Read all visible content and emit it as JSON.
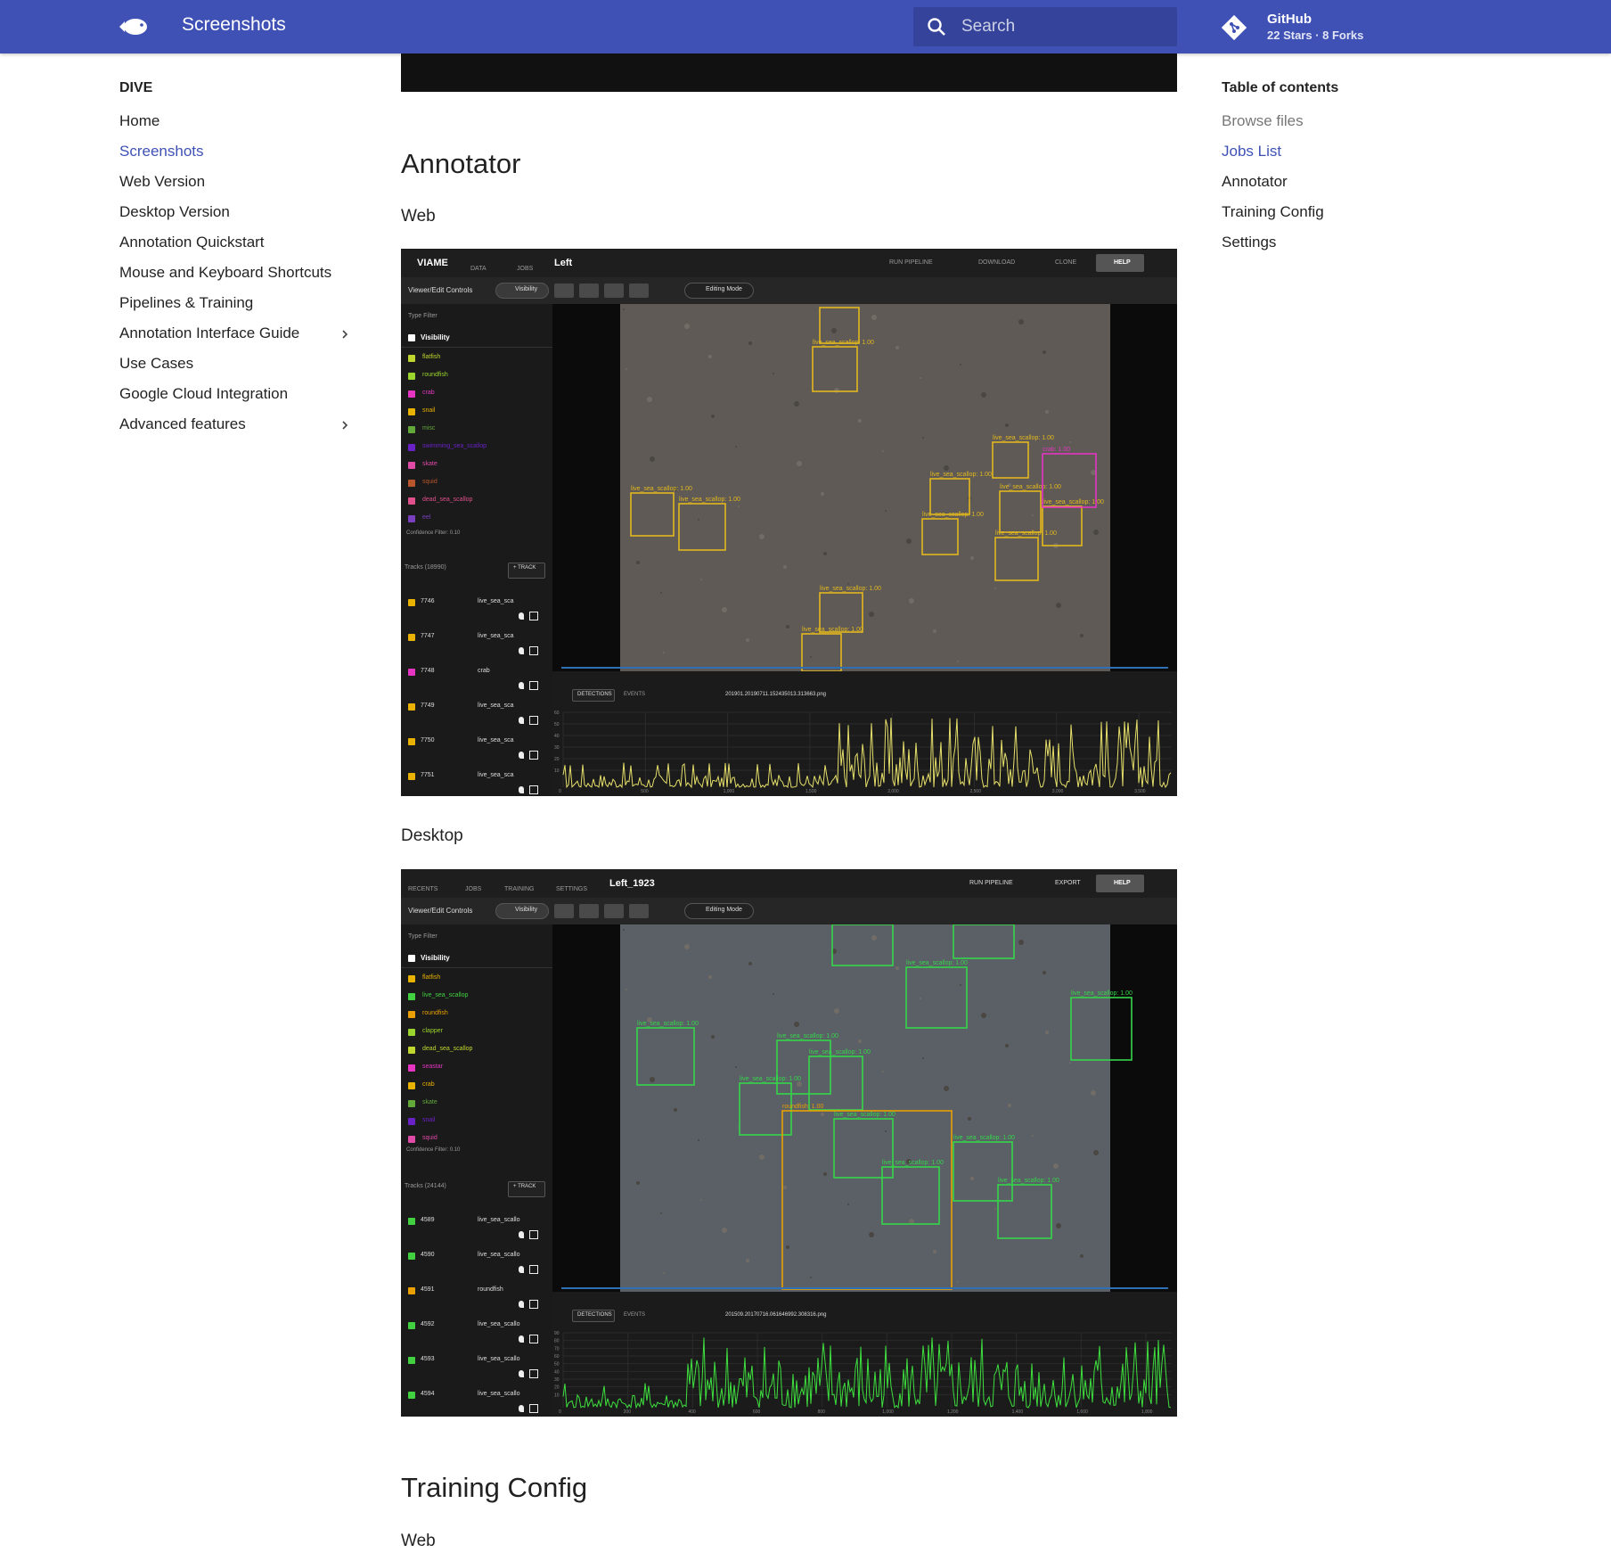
{
  "header": {
    "site_title": "Screenshots",
    "search_placeholder": "Search",
    "repo_name": "GitHub",
    "repo_facts": "22 Stars · 8 Forks",
    "brand_color": "#3f51b5"
  },
  "nav": {
    "title": "DIVE",
    "items": [
      {
        "label": "Home",
        "active": false,
        "expandable": false
      },
      {
        "label": "Screenshots",
        "active": true,
        "expandable": false
      },
      {
        "label": "Web Version",
        "active": false,
        "expandable": false
      },
      {
        "label": "Desktop Version",
        "active": false,
        "expandable": false
      },
      {
        "label": "Annotation Quickstart",
        "active": false,
        "expandable": false
      },
      {
        "label": "Mouse and Keyboard Shortcuts",
        "active": false,
        "expandable": false
      },
      {
        "label": "Pipelines & Training",
        "active": false,
        "expandable": false
      },
      {
        "label": "Annotation Interface Guide",
        "active": false,
        "expandable": true
      },
      {
        "label": "Use Cases",
        "active": false,
        "expandable": false
      },
      {
        "label": "Google Cloud Integration",
        "active": false,
        "expandable": false
      },
      {
        "label": "Advanced features",
        "active": false,
        "expandable": true
      }
    ]
  },
  "toc": {
    "title": "Table of contents",
    "items": [
      {
        "label": "Browse files",
        "state": "passed"
      },
      {
        "label": "Jobs List",
        "state": "active"
      },
      {
        "label": "Annotator",
        "state": "normal"
      },
      {
        "label": "Training Config",
        "state": "normal"
      },
      {
        "label": "Settings",
        "state": "normal"
      }
    ]
  },
  "content": {
    "annotator_heading": "Annotator",
    "web_label": "Web",
    "desktop_label": "Desktop",
    "training_heading": "Training Config",
    "training_web_label": "Web"
  },
  "screenshots": {
    "web": {
      "nav_items": [
        "VIAME",
        "DATA",
        "JOBS"
      ],
      "dataset_name": "Left",
      "actions": [
        "RUN PIPELINE",
        "DOWNLOAD",
        "CLONE",
        "HELP"
      ],
      "controls_label": "Viewer/Edit Controls",
      "visibility_label": "Visibility",
      "editing_label": "Editing Mode",
      "type_filter": "Type Filter",
      "types": [
        {
          "name": "flatfish",
          "color": "#c0d62c"
        },
        {
          "name": "roundfish",
          "color": "#9bd42c"
        },
        {
          "name": "crab",
          "color": "#e535c3"
        },
        {
          "name": "snail",
          "color": "#e9b200"
        },
        {
          "name": "misc",
          "color": "#62a83a"
        },
        {
          "name": "swimming_sea_scallop",
          "color": "#6a22c7"
        },
        {
          "name": "skate",
          "color": "#e04aa8"
        },
        {
          "name": "squid",
          "color": "#b8552c"
        },
        {
          "name": "dead_sea_scallop",
          "color": "#e0508a"
        },
        {
          "name": "eel",
          "color": "#7a3fbf"
        }
      ],
      "confidence_filter": "Confidence Filter: 0.10",
      "tracks_label": "Tracks (18990)",
      "track_button": "+ TRACK",
      "tracks": [
        {
          "id": "7746",
          "type": "live_sea_sca",
          "color": "#e9b200"
        },
        {
          "id": "7747",
          "type": "live_sea_sca",
          "color": "#e9b200"
        },
        {
          "id": "7748",
          "type": "crab",
          "color": "#e535c3"
        },
        {
          "id": "7749",
          "type": "live_sea_sca",
          "color": "#e9b200"
        },
        {
          "id": "7750",
          "type": "live_sea_sca",
          "color": "#e9b200"
        },
        {
          "id": "7751",
          "type": "live_sea_sca",
          "color": "#e9b200"
        }
      ],
      "timeline_tabs": [
        "DETECTIONS",
        "EVENTS"
      ],
      "frame_name": "201901.20190711.152435013.313663.png",
      "box_label": "live_sea_scallop: 1.00",
      "box_color": "#e2b81d",
      "crab_label": "crab: 1.00",
      "crab_color": "#e535c3",
      "x_ticks": [
        "0",
        "500",
        "1,000",
        "1,500",
        "2,000",
        "2,500",
        "3,000",
        "3,500"
      ],
      "y_ticks": [
        "60",
        "50",
        "40",
        "30",
        "20",
        "10"
      ],
      "plot_color": "#e6e06a"
    },
    "desktop": {
      "nav_items": [
        "RECENTS",
        "JOBS",
        "TRAINING",
        "SETTINGS"
      ],
      "dataset_name": "Left_1923",
      "actions": [
        "RUN PIPELINE",
        "EXPORT",
        "HELP"
      ],
      "controls_label": "Viewer/Edit Controls",
      "visibility_label": "Visibility",
      "editing_label": "Editing Mode",
      "type_filter": "Type Filter",
      "types": [
        {
          "name": "flatfish",
          "color": "#e9b200"
        },
        {
          "name": "live_sea_scallop",
          "color": "#40d040"
        },
        {
          "name": "roundfish",
          "color": "#e9a000"
        },
        {
          "name": "clapper",
          "color": "#9bd42c"
        },
        {
          "name": "dead_sea_scallop",
          "color": "#c0d62c"
        },
        {
          "name": "seastar",
          "color": "#e535c3"
        },
        {
          "name": "crab",
          "color": "#e9b200"
        },
        {
          "name": "skate",
          "color": "#62a83a"
        },
        {
          "name": "snail",
          "color": "#6a22c7"
        },
        {
          "name": "squid",
          "color": "#e04aa8"
        }
      ],
      "confidence_filter": "Confidence Filter: 0.10",
      "tracks_label": "Tracks (24144)",
      "track_button": "+ TRACK",
      "tracks": [
        {
          "id": "4589",
          "type": "live_sea_scallo",
          "color": "#40d040"
        },
        {
          "id": "4590",
          "type": "live_sea_scallo",
          "color": "#40d040"
        },
        {
          "id": "4591",
          "type": "roundfish",
          "color": "#e9a000"
        },
        {
          "id": "4592",
          "type": "live_sea_scallo",
          "color": "#40d040"
        },
        {
          "id": "4593",
          "type": "live_sea_scallo",
          "color": "#40d040"
        },
        {
          "id": "4594",
          "type": "live_sea_scallo",
          "color": "#40d040"
        }
      ],
      "timeline_tabs": [
        "DETECTIONS",
        "EVENTS"
      ],
      "frame_name": "201509.20170716.061646992.308316.png",
      "box_label": "live_sea_scallop: 1.00",
      "box_color": "#35d64a",
      "fish_label": "roundfish: 1.00",
      "fish_color": "#e9a000",
      "x_ticks": [
        "0",
        "200",
        "400",
        "600",
        "800",
        "1,000",
        "1,200",
        "1,400",
        "1,600",
        "1,800"
      ],
      "y_ticks": [
        "90",
        "80",
        "70",
        "60",
        "50",
        "40",
        "30",
        "20",
        "10"
      ],
      "plot_color": "#3ee03e"
    }
  }
}
